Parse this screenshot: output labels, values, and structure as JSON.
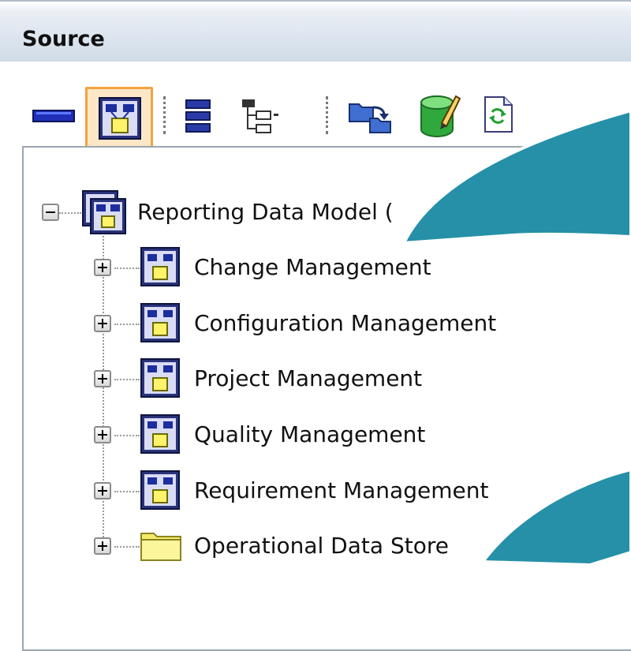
{
  "panel": {
    "title": "Source"
  },
  "toolbar": {
    "items": [
      {
        "icon": "minus-bar-icon"
      },
      {
        "icon": "data-model-icon",
        "active": true
      },
      {
        "icon": "list-view-icon"
      },
      {
        "icon": "tree-view-icon"
      },
      {
        "icon": "folder-move-icon"
      },
      {
        "icon": "edit-database-icon"
      },
      {
        "icon": "refresh-page-icon"
      }
    ]
  },
  "tree": {
    "root": {
      "label": "Reporting Data Model (",
      "icon": "data-model-icon",
      "expanded": true
    },
    "children": [
      {
        "label": "Change Management",
        "icon": "data-model-icon"
      },
      {
        "label": "Configuration Management",
        "icon": "data-model-icon"
      },
      {
        "label": "Project Management",
        "icon": "data-model-icon"
      },
      {
        "label": "Quality Management",
        "icon": "data-model-icon"
      },
      {
        "label": "Requirement Management",
        "icon": "data-model-icon"
      },
      {
        "label": "Operational Data Store",
        "icon": "folder-icon"
      }
    ]
  },
  "colors": {
    "callout": "#2590a8",
    "active_button_border": "#f3a33f"
  }
}
